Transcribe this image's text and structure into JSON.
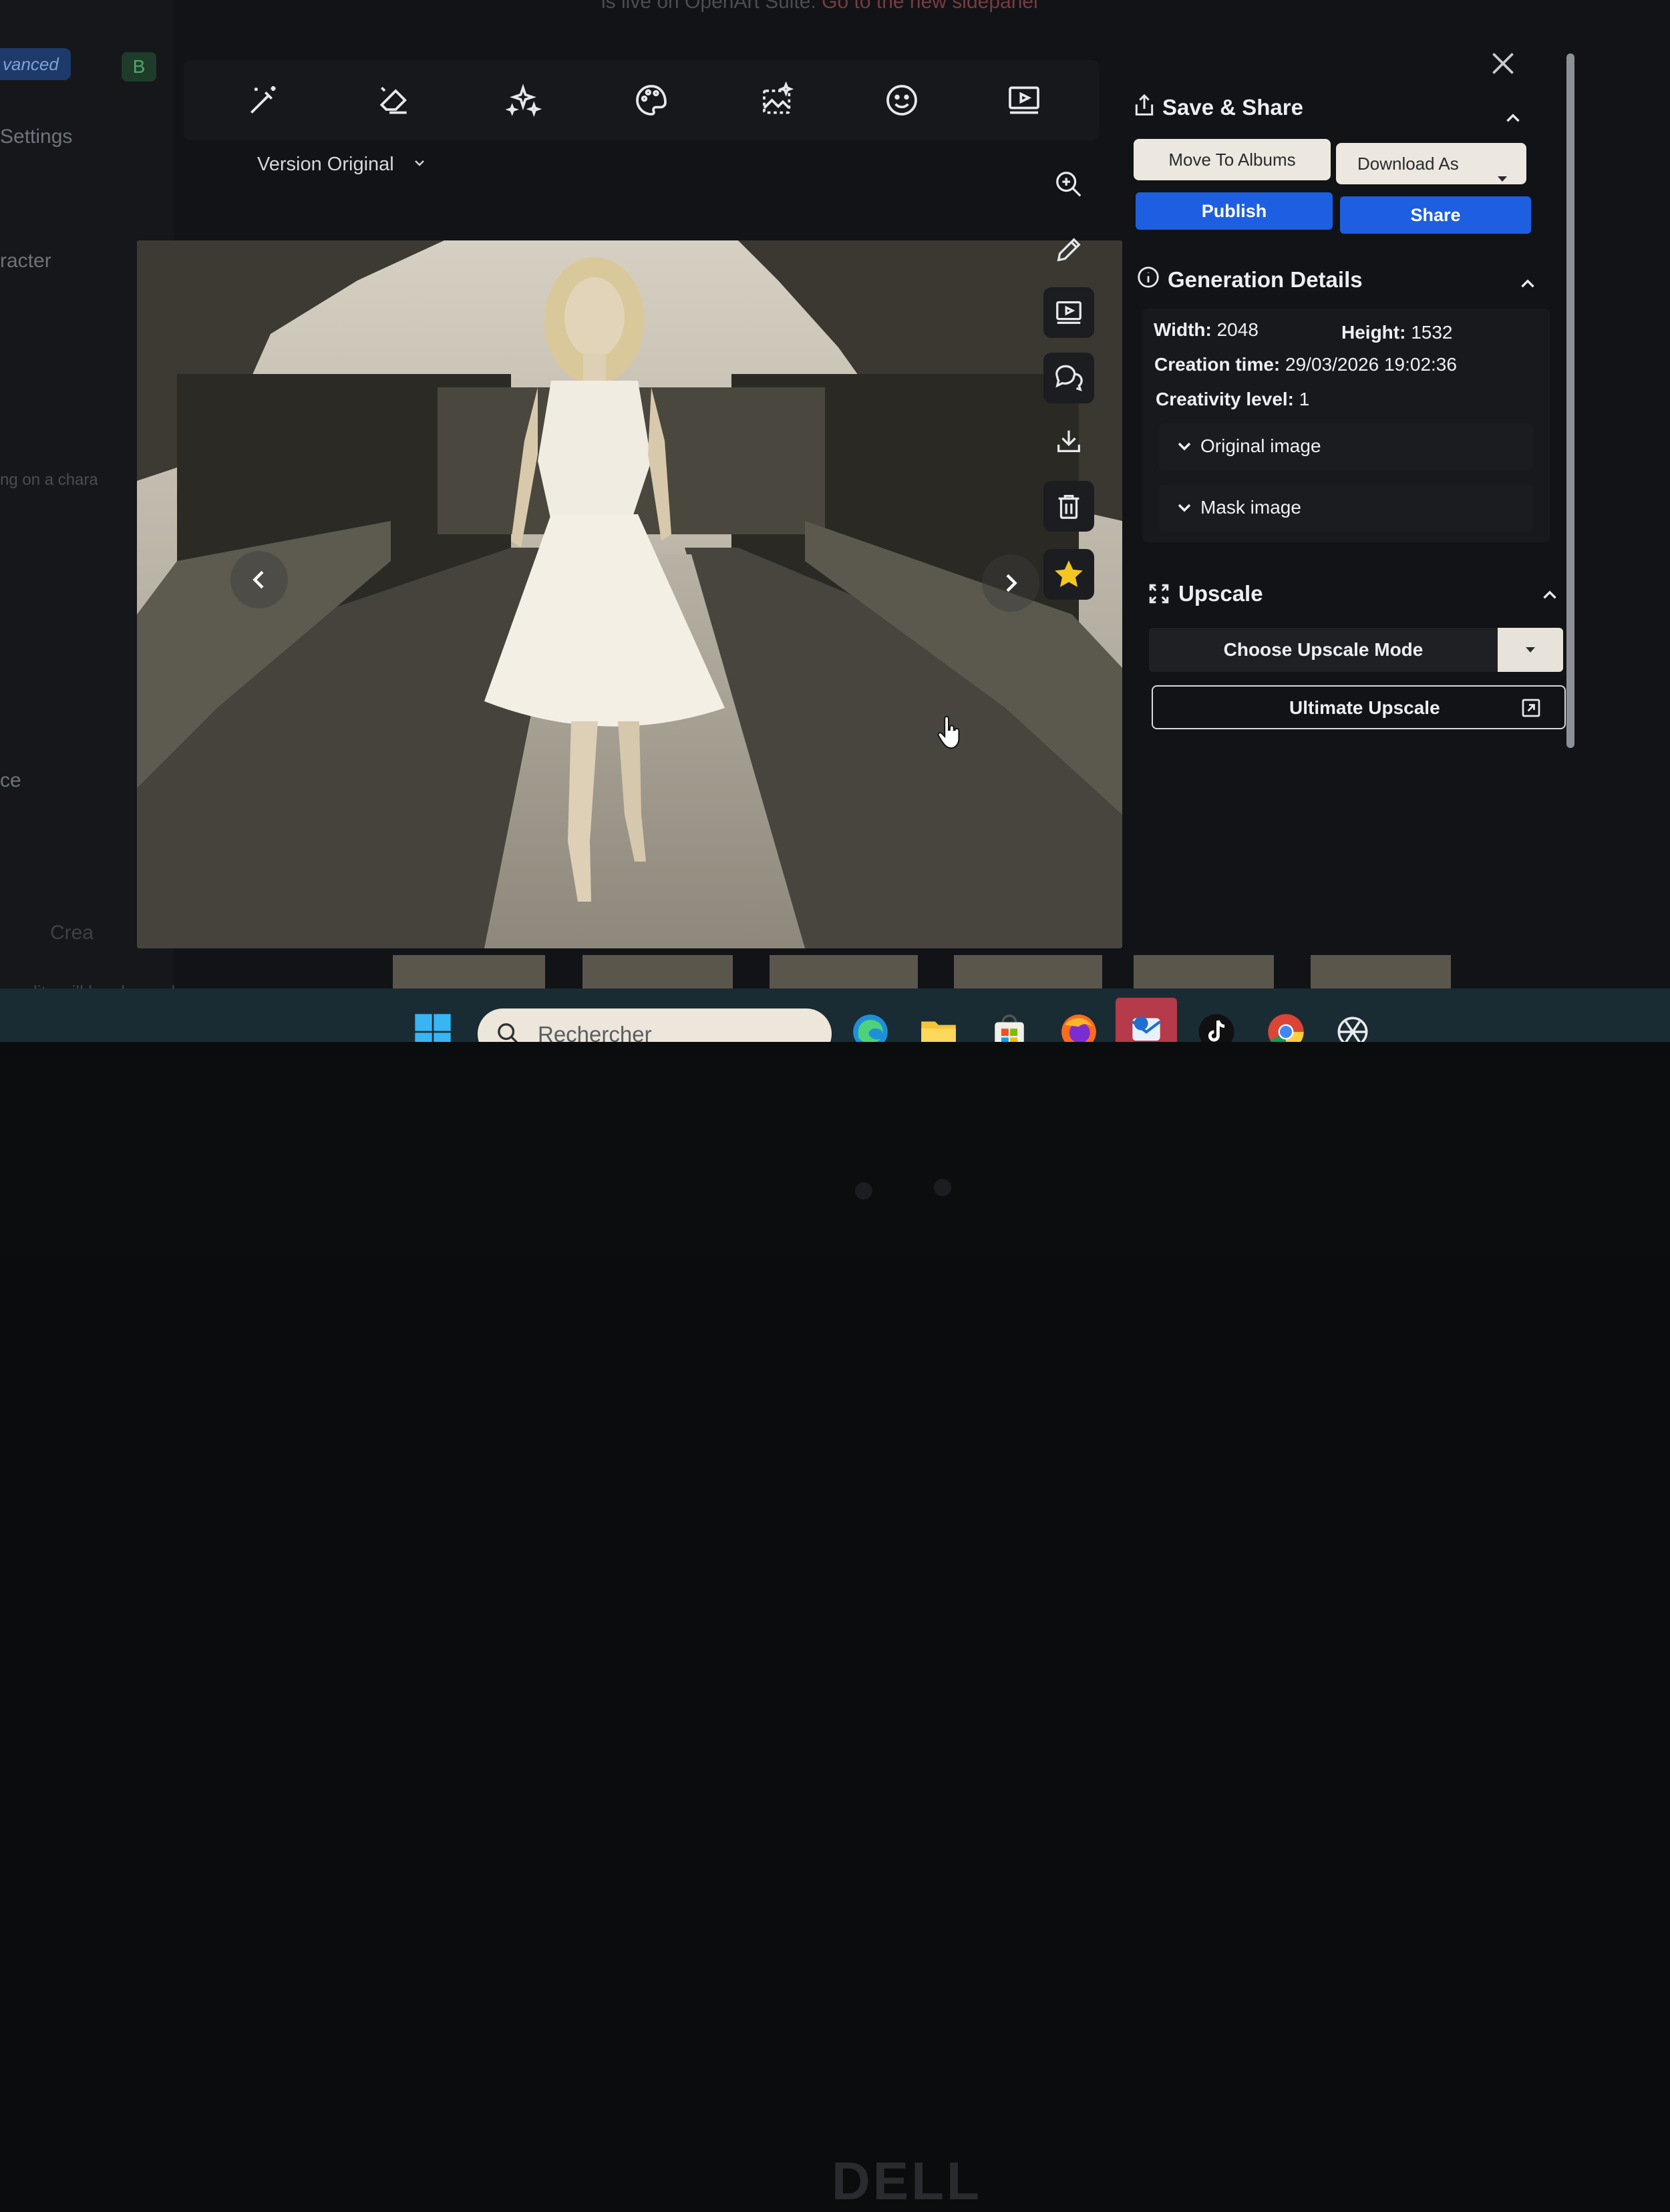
{
  "banner": {
    "text": "is live on OpenArt Suite.",
    "link": "Go to the new sidepanel"
  },
  "sidebar": {
    "advanced_label": "vanced",
    "badge_label": "B",
    "settings_label": "Settings",
    "character_label": "racter",
    "hint_label": "ng on a chara",
    "price_label": "ce",
    "create_label": "Crea",
    "credits_label": "credits will be charged"
  },
  "toolbar": {
    "tools": [
      "magic-wand-icon",
      "eraser-icon",
      "sparkles-icon",
      "palette-icon",
      "image-edit-icon",
      "face-icon",
      "video-icon"
    ]
  },
  "version_selector": {
    "label": "Version Original"
  },
  "side_actions": [
    "zoom-in-icon",
    "pencil-icon",
    "video-icon",
    "chat-icon",
    "download-icon",
    "trash-icon",
    "star-icon"
  ],
  "save_share": {
    "title": "Save & Share",
    "move_to_albums": "Move To Albums",
    "download_as": "Download As",
    "publish": "Publish",
    "share": "Share"
  },
  "generation_details": {
    "title": "Generation Details",
    "width_label": "Width:",
    "width_value": "2048",
    "height_label": "Height:",
    "height_value": "1532",
    "creation_label": "Creation time:",
    "creation_value": "29/03/2026 19:02:36",
    "creativity_label": "Creativity level:",
    "creativity_value": "1",
    "original_image": "Original image",
    "mask_image": "Mask image"
  },
  "upscale": {
    "title": "Upscale",
    "choose_mode": "Choose Upscale Mode",
    "ultimate": "Ultimate Upscale"
  },
  "taskbar": {
    "search_placeholder": "Rechercher",
    "apps": [
      "windows-start-icon",
      "edge-icon",
      "file-explorer-icon",
      "store-icon",
      "firefox-icon",
      "mail-icon",
      "tiktok-icon",
      "chrome-icon",
      "chatgpt-icon"
    ]
  },
  "laptop": {
    "brand": "DELL"
  },
  "colors": {
    "accent_blue": "#1d5fe0",
    "star_yellow": "#f3c623",
    "panel_bg": "#121317"
  }
}
